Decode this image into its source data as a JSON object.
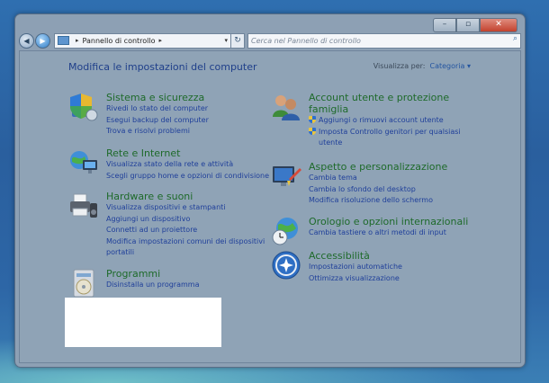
{
  "window": {
    "controls": [
      "–",
      "▫",
      "✕"
    ]
  },
  "navbar": {
    "breadcrumb": "Pannello di controllo",
    "search_placeholder": "Cerca nel Pannello di controllo"
  },
  "main": {
    "heading": "Modifica le impostazioni del computer",
    "view_by_label": "Visualizza per:",
    "view_by_value": "Categoria ▾"
  },
  "categories": [
    {
      "title": "Sistema e sicurezza",
      "icon": "shield-computer-icon",
      "links": [
        "Rivedi lo stato del computer",
        "Esegui backup del computer",
        "Trova e risolvi problemi"
      ]
    },
    {
      "title": "Rete e Internet",
      "icon": "network-globe-icon",
      "links": [
        "Visualizza stato della rete e attività",
        "Scegli gruppo home e opzioni di condivisione"
      ]
    },
    {
      "title": "Hardware e suoni",
      "icon": "printer-speaker-icon",
      "links": [
        "Visualizza dispositivi e stampanti",
        "Aggiungi un dispositivo",
        "Connetti ad un proiettore",
        "Modifica impostazioni comuni dei dispositivi",
        "portatili"
      ]
    },
    {
      "title": "Programmi",
      "icon": "programs-disc-icon",
      "links": [
        "Disinstalla un programma"
      ]
    },
    {
      "title_line1": "Account utente e protezione",
      "title_line2": "famiglia",
      "icon": "users-icon",
      "links": [
        "Aggiungi o rimuovi account utente",
        "Imposta Controllo genitori per qualsiasi",
        "utente"
      ]
    },
    {
      "title": "Aspetto e personalizzazione",
      "icon": "monitor-brush-icon",
      "links": [
        "Cambia tema",
        "Cambia lo sfondo del desktop",
        "Modifica risoluzione dello schermo"
      ]
    },
    {
      "title": "Orologio e opzioni internazionali",
      "icon": "clock-globe-icon",
      "links": [
        "Cambia tastiere o altri metodi di input"
      ]
    },
    {
      "title": "Accessibilità",
      "icon": "accessibility-icon",
      "links": [
        "Impostazioni automatiche",
        "Ottimizza visualizzazione"
      ]
    }
  ]
}
